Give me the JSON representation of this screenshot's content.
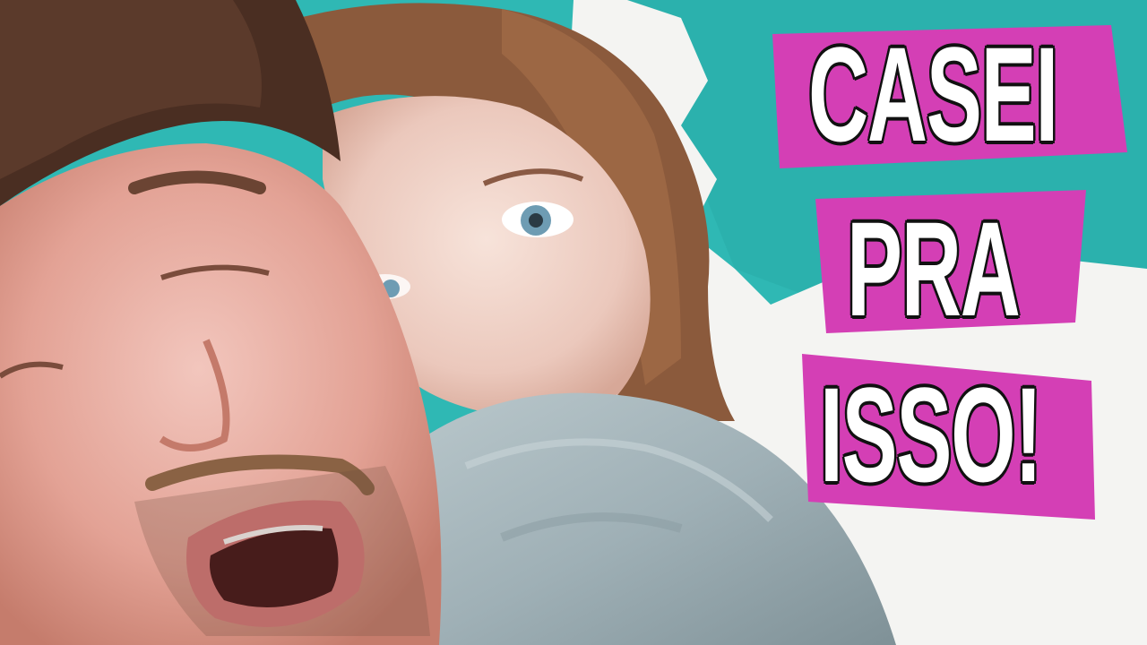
{
  "headline": {
    "line1": "CASEI",
    "line2": "PRA",
    "line3": "ISSO!"
  },
  "colors": {
    "background": "#2fb8b4",
    "highlight": "#d43fb5",
    "text": "#ffffff",
    "outline": "#111111"
  }
}
